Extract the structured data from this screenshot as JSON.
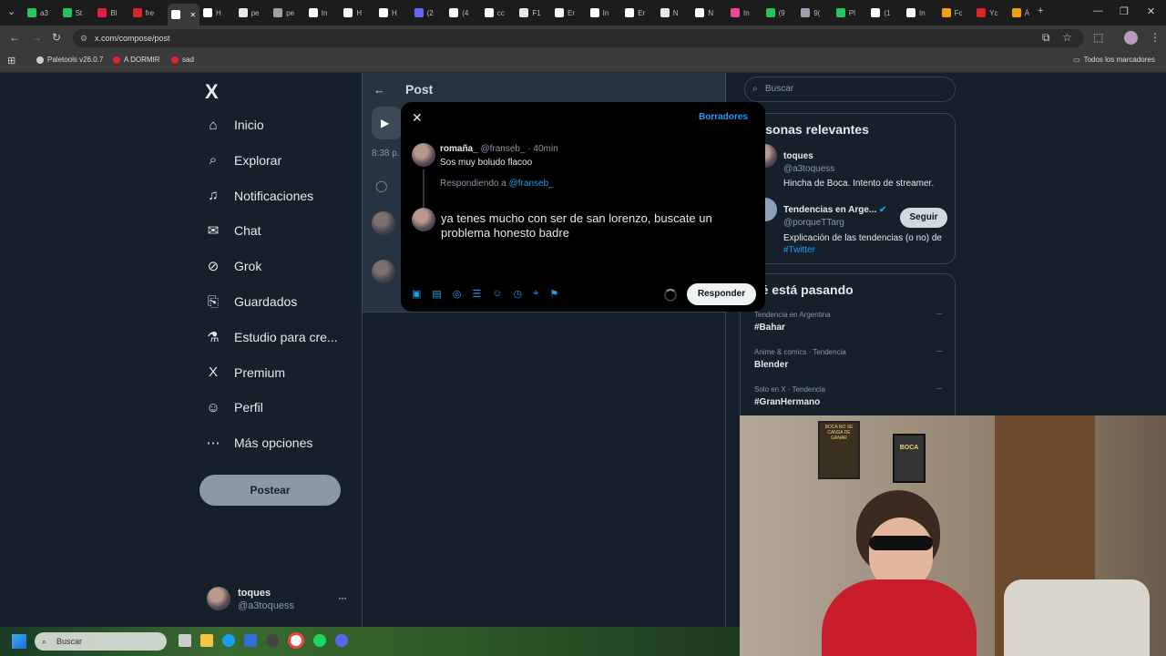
{
  "browser": {
    "tabs": [
      {
        "label": "a3",
        "color": "#22c55e"
      },
      {
        "label": "St",
        "color": "#22c55e"
      },
      {
        "label": "Bl",
        "color": "#e11d48"
      },
      {
        "label": "fre",
        "color": "#dc2626"
      },
      {
        "label": "",
        "color": "#ffffff"
      },
      {
        "label": "H",
        "color": "#ffffff"
      },
      {
        "label": "pe",
        "color": "#e5e7eb"
      },
      {
        "label": "pe",
        "color": "#9ca3af"
      },
      {
        "label": "In",
        "color": "#ffffff"
      },
      {
        "label": "H",
        "color": "#ffffff"
      },
      {
        "label": "H",
        "color": "#ffffff"
      },
      {
        "label": "(2",
        "color": "#6366f1"
      },
      {
        "label": "(4",
        "color": "#ffffff"
      },
      {
        "label": "cc",
        "color": "#ffffff"
      },
      {
        "label": "F1",
        "color": "#e5e7eb"
      },
      {
        "label": "Er",
        "color": "#ffffff"
      },
      {
        "label": "In",
        "color": "#ffffff"
      },
      {
        "label": "Er",
        "color": "#ffffff"
      },
      {
        "label": "N",
        "color": "#e5e7eb"
      },
      {
        "label": "N",
        "color": "#ffffff"
      },
      {
        "label": "In",
        "color": "#ec4899"
      },
      {
        "label": "(9",
        "color": "#22c55e"
      },
      {
        "label": "9(",
        "color": "#9ca3af"
      },
      {
        "label": "Pl",
        "color": "#22c55e"
      },
      {
        "label": "(1",
        "color": "#ffffff"
      },
      {
        "label": "In",
        "color": "#ffffff"
      },
      {
        "label": "Fc",
        "color": "#f59e0b"
      },
      {
        "label": "Yc",
        "color": "#dc2626"
      },
      {
        "label": "Á",
        "color": "#f59e0b"
      }
    ],
    "url": "x.com/compose/post",
    "bookmarks": [
      {
        "label": "Paletools v26.0.7",
        "color": "#cccccc"
      },
      {
        "label": "A DORMIR",
        "color": "#dc2626"
      },
      {
        "label": "sad",
        "color": "#dc2626"
      }
    ],
    "all_bookmarks": "Todos los marcadores"
  },
  "sidebar": {
    "logo": "X",
    "items": [
      {
        "label": "Inicio",
        "icon": "home-icon"
      },
      {
        "label": "Explorar",
        "icon": "search-icon"
      },
      {
        "label": "Notificaciones",
        "icon": "bell-icon"
      },
      {
        "label": "Chat",
        "icon": "mail-icon"
      },
      {
        "label": "Grok",
        "icon": "grok-icon"
      },
      {
        "label": "Guardados",
        "icon": "bookmark-icon"
      },
      {
        "label": "Estudio para cre...",
        "icon": "flask-icon"
      },
      {
        "label": "Premium",
        "icon": "x-premium-icon"
      },
      {
        "label": "Perfil",
        "icon": "person-icon"
      },
      {
        "label": "Más opciones",
        "icon": "more-circle-icon"
      }
    ],
    "post_button": "Postear",
    "account": {
      "name": "toques",
      "handle": "@a3toquess",
      "more": "···"
    }
  },
  "main": {
    "header_title": "Post",
    "time_fragment": "8:38 p."
  },
  "modal": {
    "drafts": "Borradores",
    "original": {
      "name": "romaña_",
      "handle": "@franseb_",
      "time": "· 40min",
      "text": "Sos muy boludo flacoo"
    },
    "replying_prefix": "Respondiendo a",
    "replying_to": "@franseb_",
    "reply_line1": "ya tenes mucho con ser de san lorenzo, buscate un",
    "reply_line2": "problema honesto badre",
    "reply_button": "Responder"
  },
  "right": {
    "search_placeholder": "Buscar",
    "relevant_title": "ersonas relevantes",
    "people": [
      {
        "name": "toques",
        "handle": "@a3toquess",
        "bio": "Hincha de Boca. Intento de streamer."
      },
      {
        "name": "Tendencias en Arge...",
        "handle": "@porqueTTarg",
        "bio": "Explicación de las tendencias (o no) de",
        "bio_link": "#Twitter",
        "follow": "Seguir"
      }
    ],
    "happening_title": "ué está pasando",
    "trends": [
      {
        "context": "Tendencia en Argentina",
        "name": "#Bahar"
      },
      {
        "context": "Anime & comics · Tendencia",
        "name": "Blender"
      },
      {
        "context": "Solo en X · Tendencia",
        "name": "#GranHermano"
      }
    ],
    "trend_more": "···"
  },
  "taskbar": {
    "search_placeholder": "Buscar"
  },
  "webcam": {
    "poster1": "BOCA NO SE CANSA DE GANAR",
    "poster2": "BOCA"
  }
}
